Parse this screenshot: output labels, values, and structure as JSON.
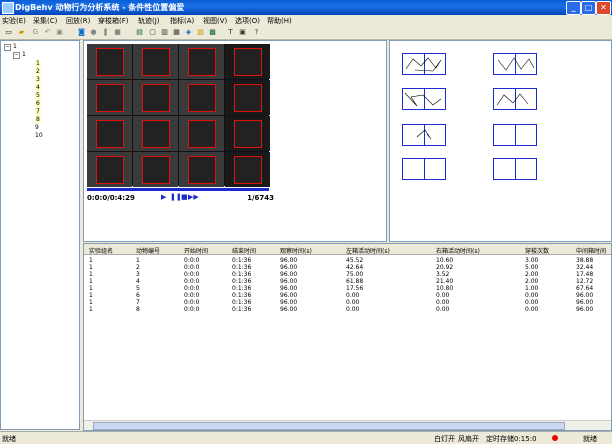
{
  "window": {
    "title": "DigBehv 动物行为分析系统 - 条件性位置偏爱"
  },
  "menu": [
    "实验(E)",
    "采集(C)",
    "回放(R)",
    "穿梭箱(F)",
    "轨迹(J)",
    "指标(A)",
    "视图(V)",
    "选项(O)",
    "帮助(H)"
  ],
  "tree": {
    "root": "1",
    "child": "1",
    "items": [
      "1",
      "2",
      "3",
      "4",
      "5",
      "6",
      "7",
      "8",
      "9",
      "10"
    ]
  },
  "player": {
    "time": "0:0:0/0:4:29",
    "frame": "1/6743",
    "controls": [
      "▶",
      "❚❚",
      "■",
      "▶▶"
    ]
  },
  "table": {
    "headers": [
      "实验组名",
      "动物编号",
      "开始时间",
      "结束时间",
      "观察时间(s)",
      "左箱活动时间(s)",
      "右箱活动时间(s)",
      "穿梭次数",
      "中间箱时间"
    ],
    "rows": [
      [
        "1",
        "1",
        "0:0:0",
        "0:1:36",
        "96.00",
        "45.52",
        "10.60",
        "3.00",
        "38.88"
      ],
      [
        "1",
        "2",
        "0:0:0",
        "0:1:36",
        "96.00",
        "42.64",
        "20.92",
        "5.00",
        "32.44"
      ],
      [
        "1",
        "3",
        "0:0:0",
        "0:1:36",
        "96.00",
        "75.00",
        "3.52",
        "2.00",
        "17.48"
      ],
      [
        "1",
        "4",
        "0:0:0",
        "0:1:36",
        "96.00",
        "61.88",
        "21.40",
        "2.00",
        "12.72"
      ],
      [
        "1",
        "5",
        "0:0:0",
        "0:1:36",
        "96.00",
        "17.56",
        "10.80",
        "1.00",
        "67.64"
      ],
      [
        "1",
        "6",
        "0:0:0",
        "0:1:36",
        "96.00",
        "0.00",
        "0.00",
        "0.00",
        "96.00"
      ],
      [
        "1",
        "7",
        "0:0:0",
        "0:1:36",
        "96.00",
        "0.00",
        "0.00",
        "0.00",
        "96.00"
      ],
      [
        "1",
        "8",
        "0:0:0",
        "0:1:36",
        "96.00",
        "0.00",
        "0.00",
        "0.00",
        "96.00"
      ]
    ]
  },
  "status": {
    "left": "就绪",
    "light": "白灯开",
    "fan": "风扇开",
    "timer": "定时存储0:15:0",
    "state": "就绪"
  }
}
